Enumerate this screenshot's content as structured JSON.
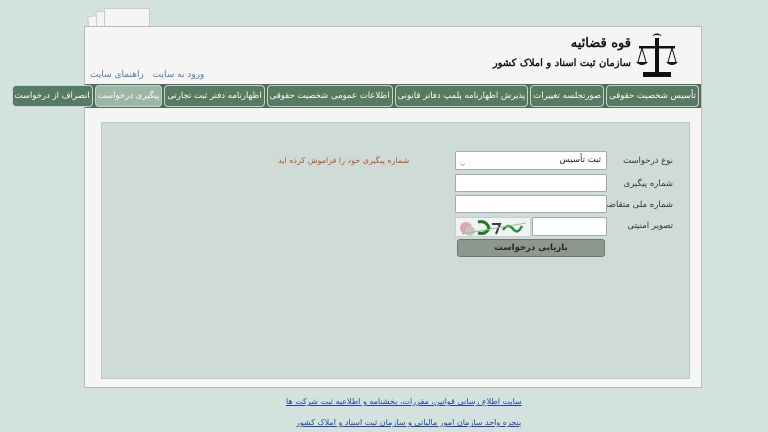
{
  "header": {
    "logo_title": "قوه قضائیه",
    "logo_subtitle": "سازمان ثبت اسناد و املاک کشور",
    "links": [
      {
        "label": "ورود به سایت"
      },
      {
        "label": "راهنمای سایت"
      }
    ]
  },
  "nav": {
    "items": [
      {
        "label": "تأسیس شخصیت حقوقی"
      },
      {
        "label": "صورتجلسه تغییرات"
      },
      {
        "label": "پذیرش اظهارنامه پلمپ دفاتر قانونی"
      },
      {
        "label": "اطلاعات عمومی شخصیت حقوقی"
      },
      {
        "label": "اظهارنامه دفتر ثبت تجارتی"
      },
      {
        "label": "پیگیری درخواست"
      },
      {
        "label": "انصراف از درخواست"
      }
    ],
    "active_index": 5
  },
  "form": {
    "request_type_label": "نوع درخواست",
    "request_type_value": "ثبت تأسیس",
    "tracking_label": "شماره پیگیری",
    "tracking_value": "",
    "national_id_label": "شماره ملی متقاضی",
    "national_id_value": "",
    "captcha_label": "تصویر امنیتی",
    "captcha_value": "",
    "forgot_link": "شماره پیگیری خود را فراموش کرده اید",
    "submit_label": "بازیابی درخواست"
  },
  "footer": {
    "links": [
      {
        "label": "سایت اطلاع رسانی قوانین، مقررات، بخشنامه و اطلاعیه ثبت شرکت ها"
      },
      {
        "label": "پنجره واحد سازمان امور مالیاتی و سازمان ثبت اسناد و املاک کشور"
      }
    ]
  },
  "colors": {
    "background": "#d3e2dd",
    "navbar": "#4f6d59",
    "nav_active": "#9fb5a3",
    "panel": "#cfdbd6",
    "link": "#2441a8",
    "forgot": "#b5552b",
    "submit": "#8e9690"
  }
}
